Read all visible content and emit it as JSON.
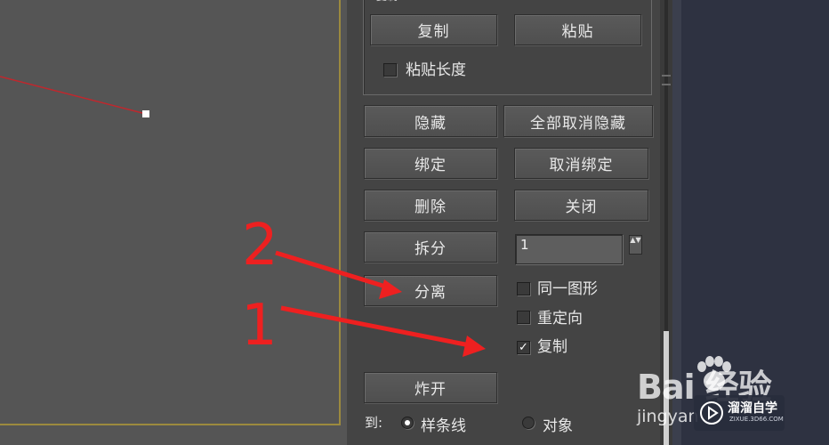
{
  "clipboard": {
    "top_label": "复制",
    "copy_label": "复制",
    "paste_label": "粘贴",
    "paste_length_label": "粘贴长度",
    "paste_length_checked": false
  },
  "buttons": {
    "hide": "隐藏",
    "unhide_all": "全部取消隐藏",
    "bind": "绑定",
    "unbind": "取消绑定",
    "delete": "删除",
    "close": "关闭",
    "divide": "拆分",
    "detach": "分离",
    "explode": "炸开"
  },
  "divide_spinner": {
    "value": "1",
    "arrows": "▲▼"
  },
  "detach_options": [
    {
      "label": "同一图形",
      "checked": false
    },
    {
      "label": "重定向",
      "checked": false
    },
    {
      "label": "复制",
      "checked": true
    }
  ],
  "explode_to": {
    "label": "到:",
    "options": [
      {
        "label": "样条线",
        "selected": true
      },
      {
        "label": "对象",
        "selected": false
      }
    ]
  },
  "annotations": {
    "step_1": "1",
    "step_2": "2",
    "color": "#ee2020"
  },
  "watermarks": {
    "baidu": "Bai 经验",
    "jingyan_url": "jingyan",
    "liuliu_name": "溜溜自学",
    "liuliu_url": "ZIXUE.3D66.COM"
  },
  "colors": {
    "viewport_bg": "#555555",
    "viewport_border": "#9c8a3e",
    "panel_bg": "#444444",
    "spline": "#c0272d"
  }
}
